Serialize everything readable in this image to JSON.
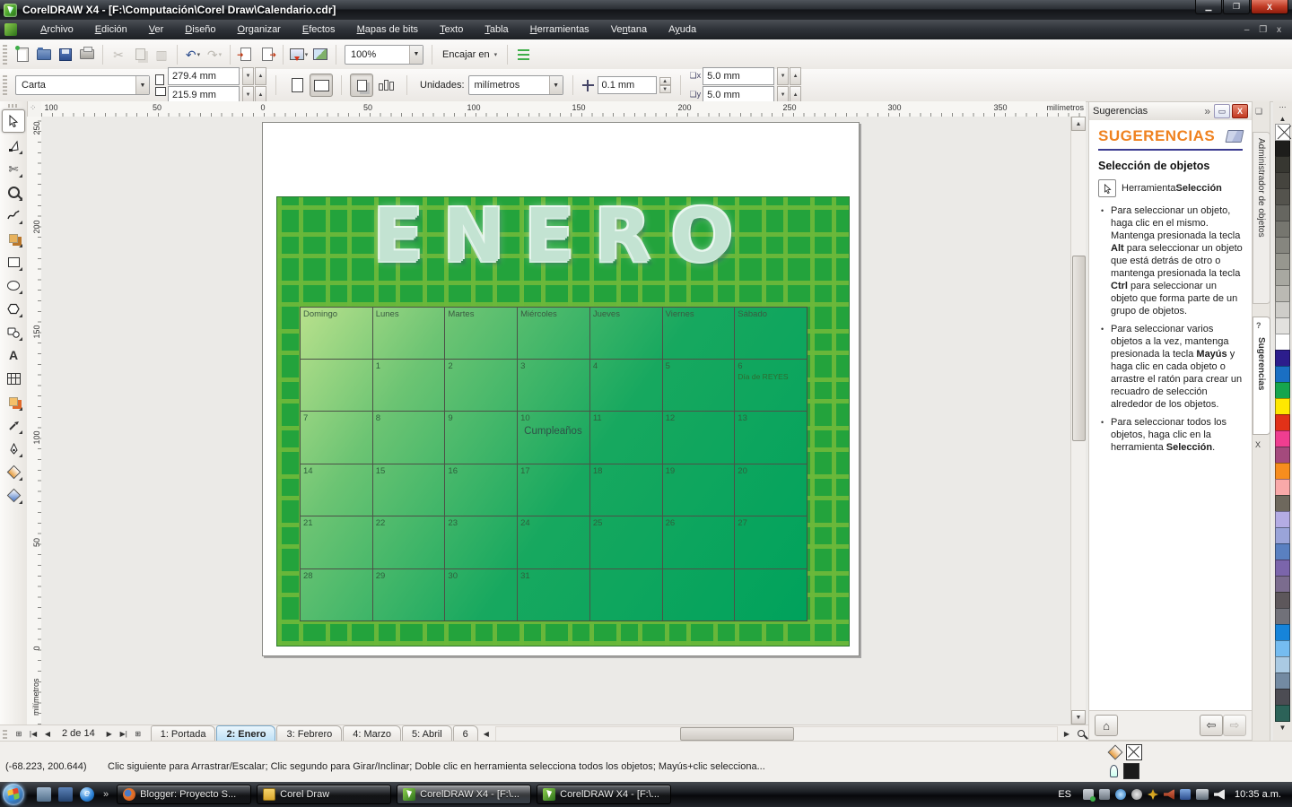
{
  "titlebar": {
    "title": "CorelDRAW X4 - [F:\\Computación\\Corel Draw\\Calendario.cdr]"
  },
  "menu": {
    "items": [
      [
        {
          "t": "A",
          "u": true
        },
        {
          "t": "rchivo"
        }
      ],
      [
        {
          "t": "E",
          "u": true
        },
        {
          "t": "dición"
        }
      ],
      [
        {
          "t": "V",
          "u": true
        },
        {
          "t": "er"
        }
      ],
      [
        {
          "t": "D",
          "u": true
        },
        {
          "t": "iseño"
        }
      ],
      [
        {
          "t": "O",
          "u": true
        },
        {
          "t": "rganizar"
        }
      ],
      [
        {
          "t": "E",
          "u": true
        },
        {
          "t": "fectos"
        }
      ],
      [
        {
          "t": "M",
          "u": true
        },
        {
          "t": "apas de bits"
        }
      ],
      [
        {
          "t": "T",
          "u": true
        },
        {
          "t": "exto"
        }
      ],
      [
        {
          "t": "T",
          "u": true
        },
        {
          "t": "abla"
        }
      ],
      [
        {
          "t": "H",
          "u": true
        },
        {
          "t": "erramientas"
        }
      ],
      [
        {
          "t": "Ve"
        },
        {
          "t": "n",
          "u": true
        },
        {
          "t": "tana"
        }
      ],
      [
        {
          "t": "A"
        },
        {
          "t": "y",
          "u": true
        },
        {
          "t": "uda"
        }
      ]
    ]
  },
  "toolbar": {
    "zoom_value": "100%",
    "snap_label": "Encajar en"
  },
  "property_bar": {
    "paper_name": "Carta",
    "paper_width": "279.4 mm",
    "paper_height": "215.9 mm",
    "units_label": "Unidades:",
    "units_value": "milímetros",
    "nudge_value": "0.1 mm",
    "duplicate_x": "5.0 mm",
    "duplicate_y": "5.0 mm"
  },
  "rulers": {
    "horizontal_ticks": [
      "100",
      "50",
      "0",
      "50",
      "100",
      "150",
      "200",
      "250",
      "300",
      "350"
    ],
    "horizontal_unit": "milímetros",
    "vertical_ticks": [
      "250",
      "200",
      "150",
      "100",
      "50",
      "0"
    ],
    "vertical_unit": "milímetros"
  },
  "artwork": {
    "title": "ENERO",
    "colors": {
      "background": "#23a33c",
      "pattern": "#a6c93a",
      "table_light": "#b9e18c",
      "table_dark": "#00a25c"
    },
    "calendar": {
      "day_headers": [
        "Domingo",
        "Lunes",
        "Martes",
        "Miércoles",
        "Jueves",
        "Viernes",
        "Sábado"
      ],
      "weeks": [
        [
          "",
          "1",
          "2",
          "3",
          "4",
          "5",
          "6"
        ],
        [
          "7",
          "8",
          "9",
          "10",
          "11",
          "12",
          "13"
        ],
        [
          "14",
          "15",
          "16",
          "17",
          "18",
          "19",
          "20"
        ],
        [
          "21",
          "22",
          "23",
          "24",
          "25",
          "26",
          "27"
        ],
        [
          "28",
          "29",
          "30",
          "31",
          "",
          "",
          ""
        ]
      ],
      "events": {
        "reyes": {
          "day": "6",
          "label": "Día de REYES"
        },
        "birthday": {
          "day": "10",
          "label": "Cumpleaños"
        }
      }
    }
  },
  "docker": {
    "tab_title": "Sugerencias",
    "chevron": "»",
    "header": "SUGERENCIAS",
    "section": "Selección de objetos",
    "tool_prefix": "Herramienta ",
    "tool_name": "Selección",
    "bullets": [
      [
        {
          "t": "Para seleccionar un objeto, haga clic en el mismo. Mantenga presionada la tecla "
        },
        {
          "t": "Alt",
          "b": true
        },
        {
          "t": " para seleccionar un objeto que está detrás de otro o mantenga presionada la tecla "
        },
        {
          "t": "Ctrl",
          "b": true
        },
        {
          "t": " para seleccionar un objeto que forma parte de un grupo de objetos."
        }
      ],
      [
        {
          "t": "Para seleccionar varios objetos a la vez, mantenga presionada la tecla "
        },
        {
          "t": "Mayús",
          "b": true
        },
        {
          "t": " y haga clic en cada objeto o arrastre el ratón para crear un recuadro de selección alrededor de los objetos."
        }
      ],
      [
        {
          "t": "Para seleccionar todos los objetos, haga clic en la herramienta "
        },
        {
          "t": "Selección",
          "b": true
        },
        {
          "t": "."
        }
      ]
    ]
  },
  "side_tabs": {
    "manager": "Administrador de objetos",
    "tips": "Sugerencias",
    "close": "X"
  },
  "pages": {
    "position": "2 de 14",
    "tabs": [
      {
        "label": "1: Portada",
        "active": false
      },
      {
        "label": "2: Enero",
        "active": true
      },
      {
        "label": "3: Febrero",
        "active": false
      },
      {
        "label": "4: Marzo",
        "active": false
      },
      {
        "label": "5: Abril",
        "active": false
      },
      {
        "label": "6",
        "active": false
      }
    ]
  },
  "status": {
    "coords": "(-68.223, 200.644)",
    "hint": "Clic siguiente para Arrastrar/Escalar; Clic segundo para Girar/Inclinar; Doble clic en herramienta selecciona todos los objetos; Mayús+clic selecciona..."
  },
  "taskbar": {
    "language": "ES",
    "time": "10:35 a.m.",
    "buttons": [
      {
        "label": "Blogger: Proyecto S...",
        "icon": "firefox-icon",
        "active": false
      },
      {
        "label": "Corel Draw",
        "icon": "folder-icon",
        "active": false
      },
      {
        "label": "CorelDRAW X4 - [F:\\...",
        "icon": "coreldraw-icon",
        "active": true
      },
      {
        "label": "CorelDRAW X4 - [F:\\...",
        "icon": "coreldraw-icon",
        "active": false
      }
    ]
  },
  "toolbox": {
    "tools": [
      "pick",
      "shape",
      "crop",
      "zoom",
      "freehand",
      "smart-fill",
      "rectangle",
      "ellipse",
      "polygon",
      "basic-shapes",
      "text",
      "table",
      "blend",
      "eyedropper",
      "outline",
      "fill",
      "interactive-fill"
    ]
  },
  "palette": {
    "colors": [
      "#1d1d1b",
      "#373731",
      "#45443e",
      "#54534d",
      "#666660",
      "#76766f",
      "#86867f",
      "#97978f",
      "#a8a8a1",
      "#bab9b3",
      "#cecdc9",
      "#e2e1de",
      "#ffffff",
      "#2c1d8c",
      "#1a6fc3",
      "#16a54d",
      "#ffe800",
      "#e23118",
      "#ef3d90",
      "#a44a7d",
      "#f78d1e",
      "#f9a9a9",
      "#6e685d",
      "#b4ace4",
      "#9aa4d9",
      "#5a80c1",
      "#7b65ab",
      "#7b6c8e",
      "#5d575b",
      "#717179",
      "#1684da",
      "#75bcf0",
      "#aacae3",
      "#738aa2",
      "#4c4c53",
      "#2c6258"
    ]
  }
}
